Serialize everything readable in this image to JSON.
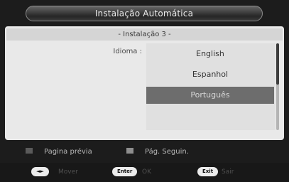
{
  "header": {
    "title": "Instalação Automática",
    "subtitle": "- Instalação 3 -"
  },
  "form": {
    "language_label": "Idioma :",
    "options": [
      {
        "label": "English",
        "selected": false
      },
      {
        "label": "Espanhol",
        "selected": false
      },
      {
        "label": "Português",
        "selected": true
      }
    ]
  },
  "legend": {
    "previous_page": {
      "label": "Pagina prévia",
      "color": "red"
    },
    "next_page": {
      "label": "Pág. Seguin.",
      "color": "green"
    }
  },
  "hints": [
    {
      "key": "◄►",
      "label": "Mover"
    },
    {
      "key": "Enter",
      "label": "OK"
    },
    {
      "key": "Exit",
      "label": "Sair"
    }
  ]
}
